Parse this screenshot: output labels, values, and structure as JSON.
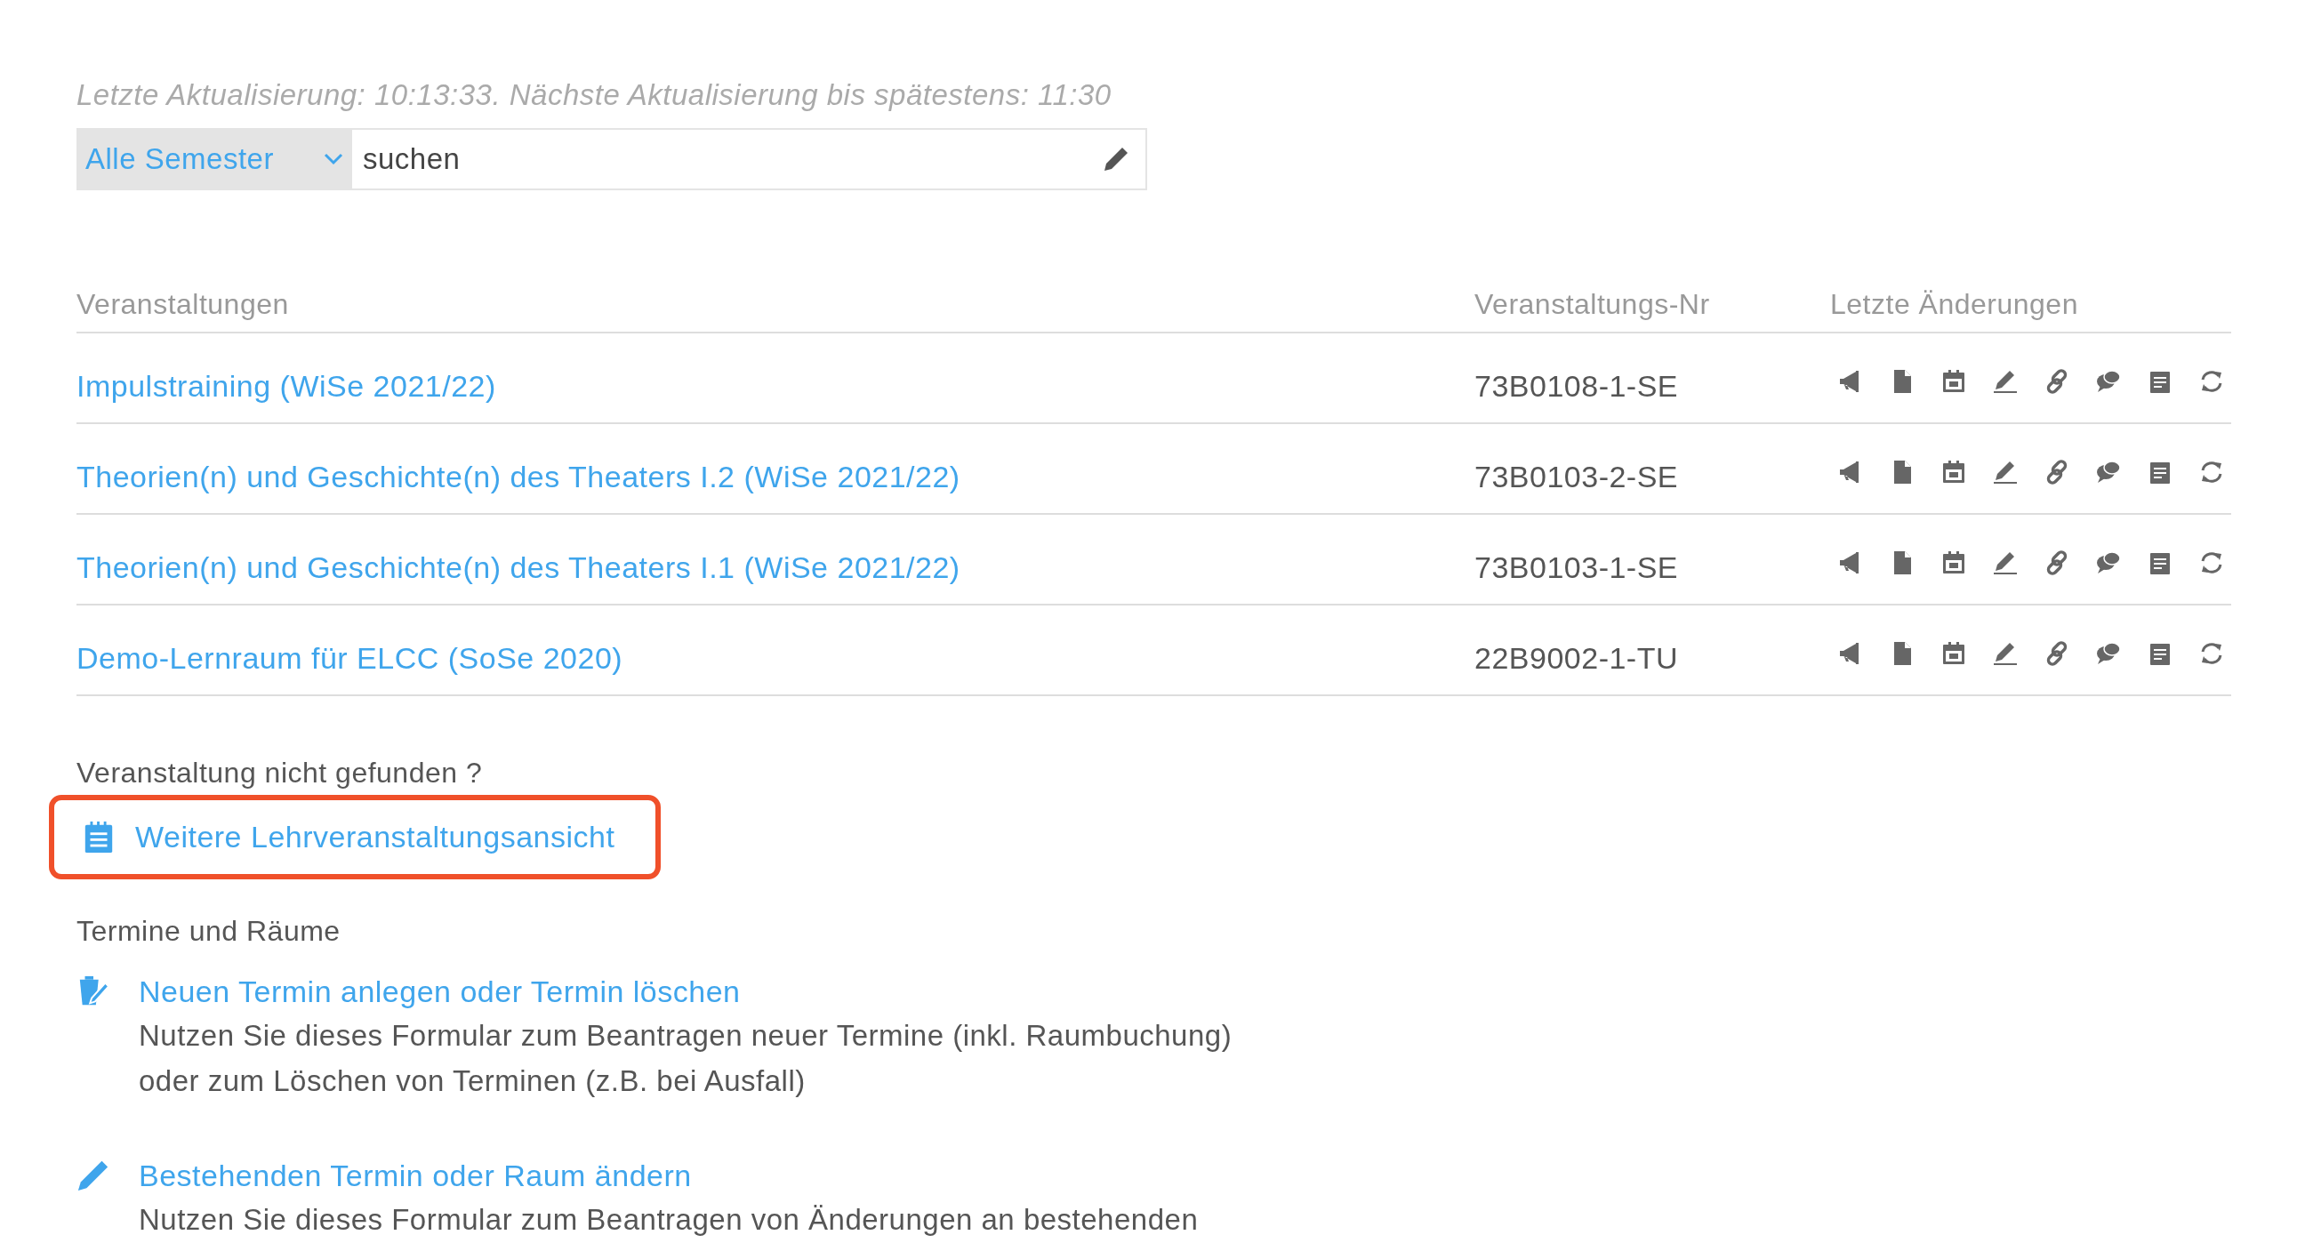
{
  "update_notice": "Letzte Aktualisierung: 10:13:33. Nächste Aktualisierung bis spätestens: 11:30",
  "filter": {
    "semester": "Alle Semester",
    "search": {
      "value": "suchen"
    }
  },
  "table": {
    "columns": [
      "Veranstaltungen",
      "Veranstaltungs-Nr",
      "Letzte Änderungen"
    ],
    "rows": [
      {
        "title": "Impulstraining (WiSe 2021/22)",
        "number": "73B0108-1-SE"
      },
      {
        "title": "Theorien(n) und Geschichte(n) des Theaters I.2 (WiSe 2021/22)",
        "number": "73B0103-2-SE"
      },
      {
        "title": "Theorien(n) und Geschichte(n) des Theaters I.1 (WiSe 2021/22)",
        "number": "73B0103-1-SE"
      },
      {
        "title": "Demo-Lernraum für ELCC (SoSe 2020)",
        "number": "22B9002-1-TU"
      }
    ]
  },
  "not_found": {
    "label": "Veranstaltung nicht gefunden ?",
    "link": {
      "text": "Weitere Lehrveranstaltungsansicht",
      "highlighted": true
    }
  },
  "rooms": {
    "title": "Termine und Räume",
    "items": [
      {
        "kind": "trash",
        "link": "Neuen Termin anlegen oder Termin löschen",
        "description": [
          "Nutzen Sie dieses Formular zum Beantragen neuer Termine (inkl. Raumbuchung)",
          "oder zum Löschen von Terminen (z.B. bei Ausfall)"
        ]
      },
      {
        "kind": "pencil",
        "link": "Bestehenden Termin oder Raum ändern",
        "description": [
          "Nutzen Sie dieses Formular zum Beantragen von Änderungen an bestehenden"
        ]
      }
    ]
  }
}
